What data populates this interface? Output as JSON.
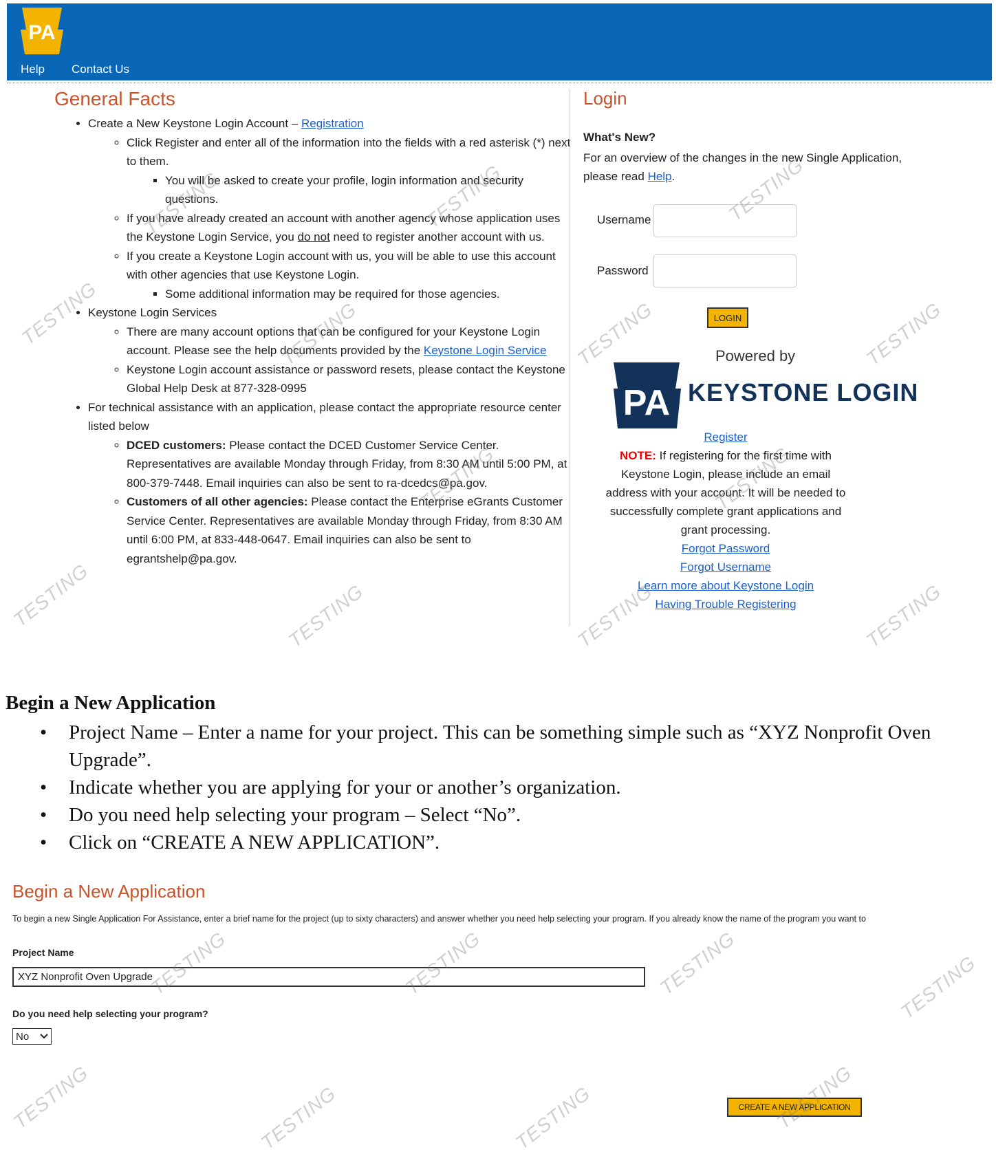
{
  "header": {
    "logo_text": "PA",
    "nav": [
      "Help",
      "Contact Us"
    ],
    "brand_color": "#0a67b7"
  },
  "general_facts": {
    "title": "General Facts",
    "item1_text": "Create a New Keystone Login Account – ",
    "item1_link": "Registration",
    "item1_sub1": "Click Register and enter all of the information into the fields with a red asterisk (*) next to them.",
    "item1_sub1_sub": "You will be asked to create your profile, login information and security questions.",
    "item1_sub2_a": "If you have already created an account with another agency whose application uses the Keystone Login Service, you ",
    "item1_sub2_u": "do not",
    "item1_sub2_b": " need to register another account with us.",
    "item1_sub3": "If you create a Keystone Login account with us, you will be able to use this account with other agencies that use Keystone Login.",
    "item1_sub3_sub": "Some additional information may be required for those agencies.",
    "item2_text": "Keystone Login Services",
    "item2_sub1_a": "There are many account options that can be configured for your Keystone Login account. Please see the help documents provided by the ",
    "item2_sub1_link": "Keystone Login Service",
    "item2_sub2": "Keystone Login account assistance or password resets, please contact the Keystone Global Help Desk at 877-328-0995",
    "item3_text": "For technical assistance with an application, please contact the appropriate resource center listed below",
    "item3_sub1_b": "DCED customers:",
    "item3_sub1": " Please contact the DCED Customer Service Center. Representatives are available Monday through Friday, from 8:30 AM until 5:00 PM, at 800-379-7448. Email inquiries can also be sent to ra-dcedcs@pa.gov.",
    "item3_sub2_b": "Customers of all other agencies:",
    "item3_sub2": " Please contact the Enterprise eGrants Customer Service Center. Representatives are available Monday through Friday, from 8:30 AM until 6:00 PM, at 833-448-0647. Email inquiries can also be sent to egrantshelp@pa.gov."
  },
  "login": {
    "title": "Login",
    "whats_new_title": "What's New?",
    "whats_new_text": "For an overview of the changes in the new Single Application, please read ",
    "whats_new_link": "Help",
    "username_label": "Username",
    "password_label": "Password",
    "login_button": "LOGIN",
    "powered_by": "Powered by",
    "logo_pa": "PA",
    "logo_text": "KEYSTONE LOGIN",
    "register_link": "Register",
    "note_label": "NOTE:",
    "note_text": " If registering for the first time with Keystone Login, please include an email address with your account. It will be needed to successfully complete grant applications and grant processing.",
    "links": [
      "Forgot Password",
      "Forgot Username",
      "Learn more about Keystone Login",
      "Having Trouble Registering"
    ]
  },
  "instructions": {
    "heading": "Begin a New Application",
    "bullets": [
      "Project Name – Enter a name for your project.  This can be something simple such as “XYZ Nonprofit Oven Upgrade”.",
      "Indicate whether you are applying for your or another’s organization.",
      "Do you need help selecting your program – Select “No”.",
      "Click on “CREATE A NEW APPLICATION”."
    ]
  },
  "begin_app": {
    "title": "Begin a New Application",
    "description": "To begin a new Single Application For Assistance, enter a brief name for the project (up to sixty characters) and answer whether you need help selecting your program. If you already know the name of the program you want to",
    "project_name_label": "Project Name",
    "project_name_value": "XYZ Nonprofit Oven Upgrade",
    "help_label": "Do you need help selecting your program?",
    "help_selected": "No",
    "create_button": "CREATE A NEW APPLICATION"
  },
  "watermark": "TESTING"
}
